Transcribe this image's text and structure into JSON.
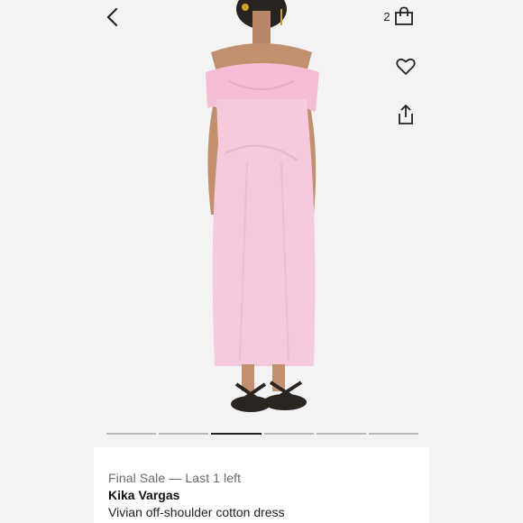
{
  "header": {
    "back_icon": "chevron-left-icon",
    "bag_count": "2",
    "bag_icon": "shopping-bag-icon"
  },
  "actions": {
    "wishlist_icon": "heart-icon",
    "share_icon": "share-icon"
  },
  "carousel": {
    "total_slides": 6,
    "active_slide": 3
  },
  "product": {
    "status": "Final Sale — Last 1 left",
    "brand": "Kika Vargas",
    "name": "Vivian off-shoulder cotton dress"
  },
  "colors": {
    "dress": "#f6c9de",
    "background": "#f3f3f3",
    "text": "#222222",
    "muted": "#6a6a6a"
  }
}
